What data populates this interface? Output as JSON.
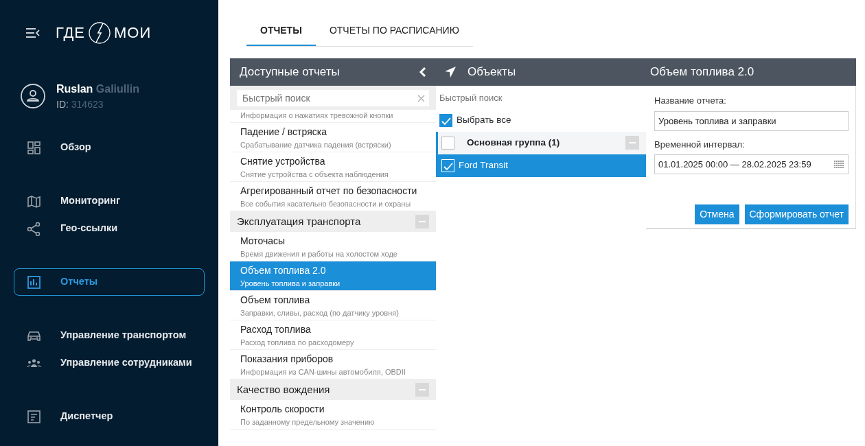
{
  "sidebar": {
    "logo": "ГДЕ МОИ",
    "user": {
      "first_name": "Ruslan",
      "last_name": "Galiullin",
      "id_label": "ID:",
      "id": "314623"
    },
    "nav_groups": [
      [
        {
          "label": "Обзор",
          "selected": false
        }
      ],
      [
        {
          "label": "Мониторинг",
          "selected": false
        },
        {
          "label": "Гео-ссылки",
          "selected": false
        }
      ],
      [
        {
          "label": "Отчеты",
          "selected": true
        }
      ],
      [
        {
          "label": "Управление транспортом",
          "selected": false
        },
        {
          "label": "Управление сотрудниками",
          "selected": false
        }
      ],
      [
        {
          "label": "Диспетчер",
          "selected": false
        }
      ]
    ]
  },
  "tabs": [
    {
      "label": "ОТЧЕТЫ",
      "selected": true
    },
    {
      "label": "ОТЧЕТЫ ПО РАСПИСАНИЮ",
      "selected": false
    }
  ],
  "reports_panel": {
    "title": "Доступные отчеты",
    "search": {
      "placeholder": "Быстрый поиск"
    },
    "items": [
      {
        "kind": "report",
        "subtitle": "Информация о нажатиях тревожной кнопки",
        "selected": false
      },
      {
        "kind": "report",
        "title": "Падение / встряска",
        "subtitle": "Срабатывание датчика падения (встряски)",
        "selected": false
      },
      {
        "kind": "report",
        "title": "Снятие устройства",
        "subtitle": "Снятие устройства с объекта наблюдения",
        "selected": false
      },
      {
        "kind": "report",
        "title": "Агрегированный отчет по безопасности",
        "subtitle": "Все события касательно безопасности и охраны",
        "selected": false
      },
      {
        "kind": "category",
        "title": "Эксплуатация транспорта"
      },
      {
        "kind": "report",
        "title": "Моточасы",
        "subtitle": "Время движения и работы на холостом ходе",
        "selected": false
      },
      {
        "kind": "report",
        "title": "Объем топлива 2.0",
        "subtitle": "Уровень топлива и заправки",
        "selected": true
      },
      {
        "kind": "report",
        "title": "Объем топлива",
        "subtitle": "Заправки, сливы, расход (по датчику уровня)",
        "selected": false
      },
      {
        "kind": "report",
        "title": "Расход топлива",
        "subtitle": "Расход топлива по расходомеру",
        "selected": false
      },
      {
        "kind": "report",
        "title": "Показания приборов",
        "subtitle": "Информация из CAN-шины автомобиля, OBDII",
        "selected": false
      },
      {
        "kind": "category",
        "title": "Качество вождения"
      },
      {
        "kind": "report",
        "title": "Контроль скорости",
        "subtitle": "По заданному предельному значению",
        "selected": false
      }
    ]
  },
  "objects_panel": {
    "title": "Объекты",
    "search": {
      "placeholder": "Быстрый поиск"
    },
    "rows": [
      {
        "kind": "select_all",
        "label": "Выбрать все",
        "checked": true,
        "selected": false
      },
      {
        "kind": "group",
        "label": "Основная группа (1)",
        "checked": false,
        "selected": false
      },
      {
        "kind": "object",
        "label": "Ford Transit",
        "checked": true,
        "selected": true
      }
    ]
  },
  "form_panel": {
    "title": "Объем топлива 2.0",
    "name_label": "Название отчета:",
    "name_value": "Уровень топлива и заправки",
    "interval_label": "Временной интервал:",
    "interval_value": "01.01.2025 00:00 — 28.02.2025 23:59",
    "buttons": [
      "Отмена",
      "Сформировать отчет"
    ]
  }
}
